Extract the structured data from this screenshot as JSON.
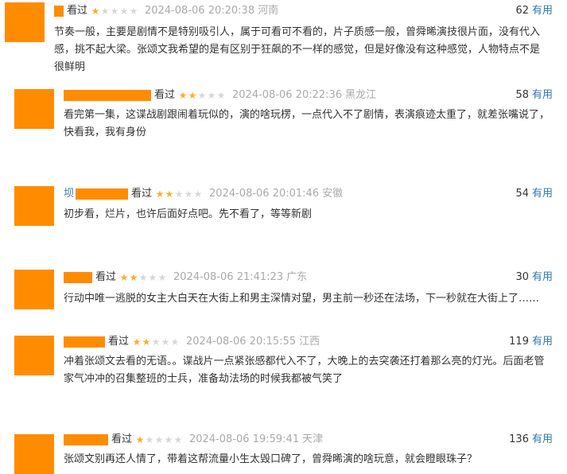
{
  "comments": [
    {
      "name": "",
      "seen": "看过",
      "rating": 1,
      "time": "2024-08-06 20:20:38",
      "location": "河南",
      "votes": "62",
      "vote_label": "有用",
      "content": "节奏一般，主要是剧情不是特别吸引人，属于可看可不看的，片子质感一般，曾舜晞演技很片面，没有代入感，挑不起大梁。张颂文我希望的是有区别于狂飙的不一样的感觉，但是好像没有这种感觉，人物特点不是很鲜明"
    },
    {
      "name": "",
      "seen": "看过",
      "rating": 2,
      "time": "2024-08-06 20:22:36",
      "location": "黑龙江",
      "votes": "58",
      "vote_label": "有用",
      "content": "看完第一集，这谍战剧跟闹着玩似的，演的啥玩楞，一点代入不了剧情，表演痕迹太重了，就差张嘴说了，快看我，我有身份"
    },
    {
      "name": "坝",
      "seen": "看过",
      "rating": 2,
      "time": "2024-08-06 20:01:46",
      "location": "安徽",
      "votes": "54",
      "vote_label": "有用",
      "content": "初步看，烂片，也许后面好点吧。先不看了，等等新剧"
    },
    {
      "name": "",
      "seen": "看过",
      "rating": 2,
      "time": "2024-08-06 21:41:23",
      "location": "广东",
      "votes": "30",
      "vote_label": "有用",
      "content": "行动中唯一逃脱的女主大白天在大街上和男主深情对望，男主前一秒还在法场，下一秒就在大街上了……"
    },
    {
      "name": "",
      "seen": "看过",
      "rating": 2,
      "time": "2024-08-06 20:15:55",
      "location": "江西",
      "votes": "119",
      "vote_label": "有用",
      "content": "冲着张颂文去看的无语。。谍战片一点紧张感都代入不了，大晚上的去突袭还打着那么亮的灯光。后面老管家气冲冲的召集整班的士兵，准备劫法场的时候我都被气笑了"
    },
    {
      "name": "",
      "seen": "看过",
      "rating": 1,
      "time": "2024-08-06 19:59:41",
      "location": "天津",
      "votes": "136",
      "vote_label": "有用",
      "content": "张颂文别再还人情了，带着这帮流量小生太毁口碑了，曾舜晞演的啥玩意，就会瞪眼珠子？"
    }
  ],
  "colors": {
    "avatar": "#FF8C00",
    "star_on": "#ffac2d",
    "star_off": "#d8d8d8",
    "link": "#3377aa",
    "muted": "#aaaaaa"
  }
}
